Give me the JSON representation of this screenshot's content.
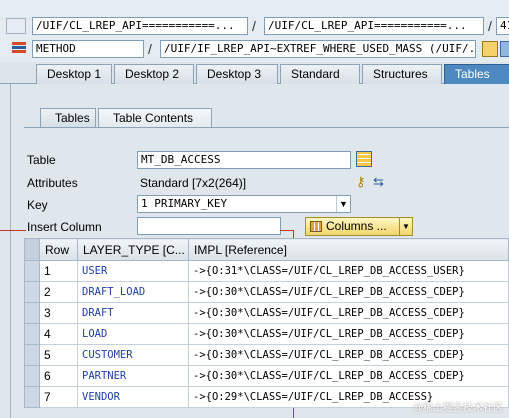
{
  "path_bar": {
    "box1": "/UIF/CL_LREP_API===========...",
    "box2": "/UIF/CL_LREP_API===========...",
    "box3": "41",
    "sep": "/"
  },
  "method_bar": {
    "method_label": "METHOD",
    "method_path": "/UIF/IF_LREP_API~EXTREF_WHERE_USED_MASS (/UIF/...",
    "sep": "/"
  },
  "outer_tabs": [
    "Desktop 1",
    "Desktop 2",
    "Desktop 3",
    "Standard",
    "Structures",
    "Tables"
  ],
  "inner_tabs": [
    "Tables",
    "Table Contents"
  ],
  "form": {
    "table_label": "Table",
    "table_value": "MT_DB_ACCESS",
    "attributes_label": "Attributes",
    "attributes_value": "Standard [7x2(264)]",
    "key_label": "Key",
    "key_value": "1 PRIMARY_KEY",
    "insert_column_label": "Insert Column",
    "insert_column_value": "",
    "columns_button": "Columns ..."
  },
  "table": {
    "headers": [
      "Row",
      "LAYER_TYPE [C...",
      "IMPL [Reference]"
    ],
    "rows": [
      [
        "1",
        "USER",
        "->{O:31*\\CLASS=/UIF/CL_LREP_DB_ACCESS_USER}"
      ],
      [
        "2",
        "DRAFT_LOAD",
        "->{O:30*\\CLASS=/UIF/CL_LREP_DB_ACCESS_CDEP}"
      ],
      [
        "3",
        "DRAFT",
        "->{O:30*\\CLASS=/UIF/CL_LREP_DB_ACCESS_CDEP}"
      ],
      [
        "4",
        "LOAD",
        "->{O:30*\\CLASS=/UIF/CL_LREP_DB_ACCESS_CDEP}"
      ],
      [
        "5",
        "CUSTOMER",
        "->{O:30*\\CLASS=/UIF/CL_LREP_DB_ACCESS_CDEP}"
      ],
      [
        "6",
        "PARTNER",
        "->{O:30*\\CLASS=/UIF/CL_LREP_DB_ACCESS_CDEP}"
      ],
      [
        "7",
        "VENDOR",
        "->{O:29*\\CLASS=/UIF/CL_LREP_DB_ACCESS}"
      ]
    ]
  },
  "watermark": "@稀土掘金技术社区"
}
